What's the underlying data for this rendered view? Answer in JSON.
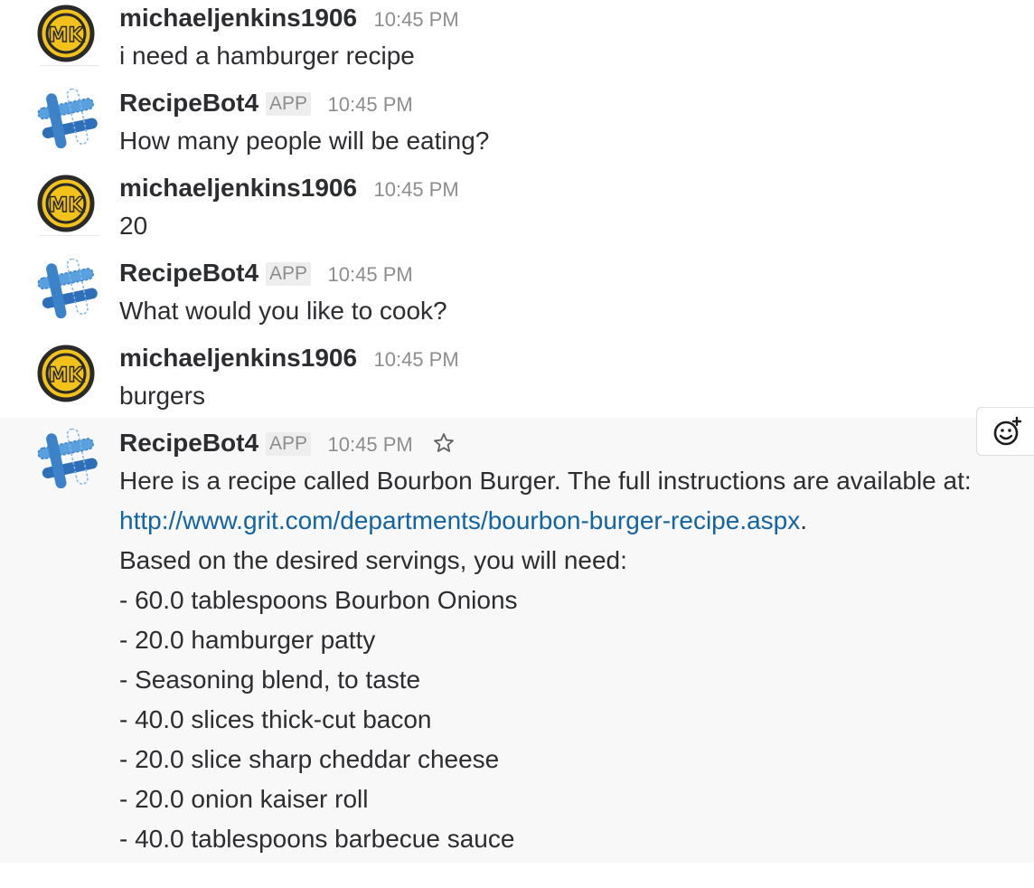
{
  "messages": [
    {
      "user": "michaeljenkins1906",
      "time": "10:45 PM",
      "text": "i need a hamburger recipe",
      "avatar": "mk-logo-icon"
    },
    {
      "user": "RecipeBot4",
      "badge": "APP",
      "time": "10:45 PM",
      "text": "How many people will be eating?",
      "avatar": "recipebot-icon"
    },
    {
      "user": "michaeljenkins1906",
      "time": "10:45 PM",
      "text": "20",
      "avatar": "mk-logo-icon"
    },
    {
      "user": "RecipeBot4",
      "badge": "APP",
      "time": "10:45 PM",
      "text": "What would you like to cook?",
      "avatar": "recipebot-icon"
    },
    {
      "user": "michaeljenkins1906",
      "time": "10:45 PM",
      "text": "burgers",
      "avatar": "mk-logo-icon"
    }
  ],
  "recipe_message": {
    "user": "RecipeBot4",
    "badge": "APP",
    "time": "10:45 PM",
    "intro": "Here is a recipe called Bourbon Burger. The full instructions are available at:",
    "link": "http://www.grit.com/departments/bourbon-burger-recipe.aspx",
    "link_suffix": ".",
    "servings_line": "Based on the desired servings, you will need:",
    "ingredients": [
      "- 60.0 tablespoons Bourbon Onions",
      "- 20.0 hamburger patty",
      "- Seasoning blend, to taste",
      "- 40.0 slices thick-cut bacon",
      "- 20.0 slice sharp cheddar cheese",
      "- 20.0 onion kaiser roll",
      "- 40.0 tablespoons barbecue sauce"
    ]
  },
  "colors": {
    "link": "#1264a3",
    "highlight_bg": "#f8f8f8",
    "mk_yellow": "#f2c21b",
    "bot_blue": "#2f7cc4"
  }
}
